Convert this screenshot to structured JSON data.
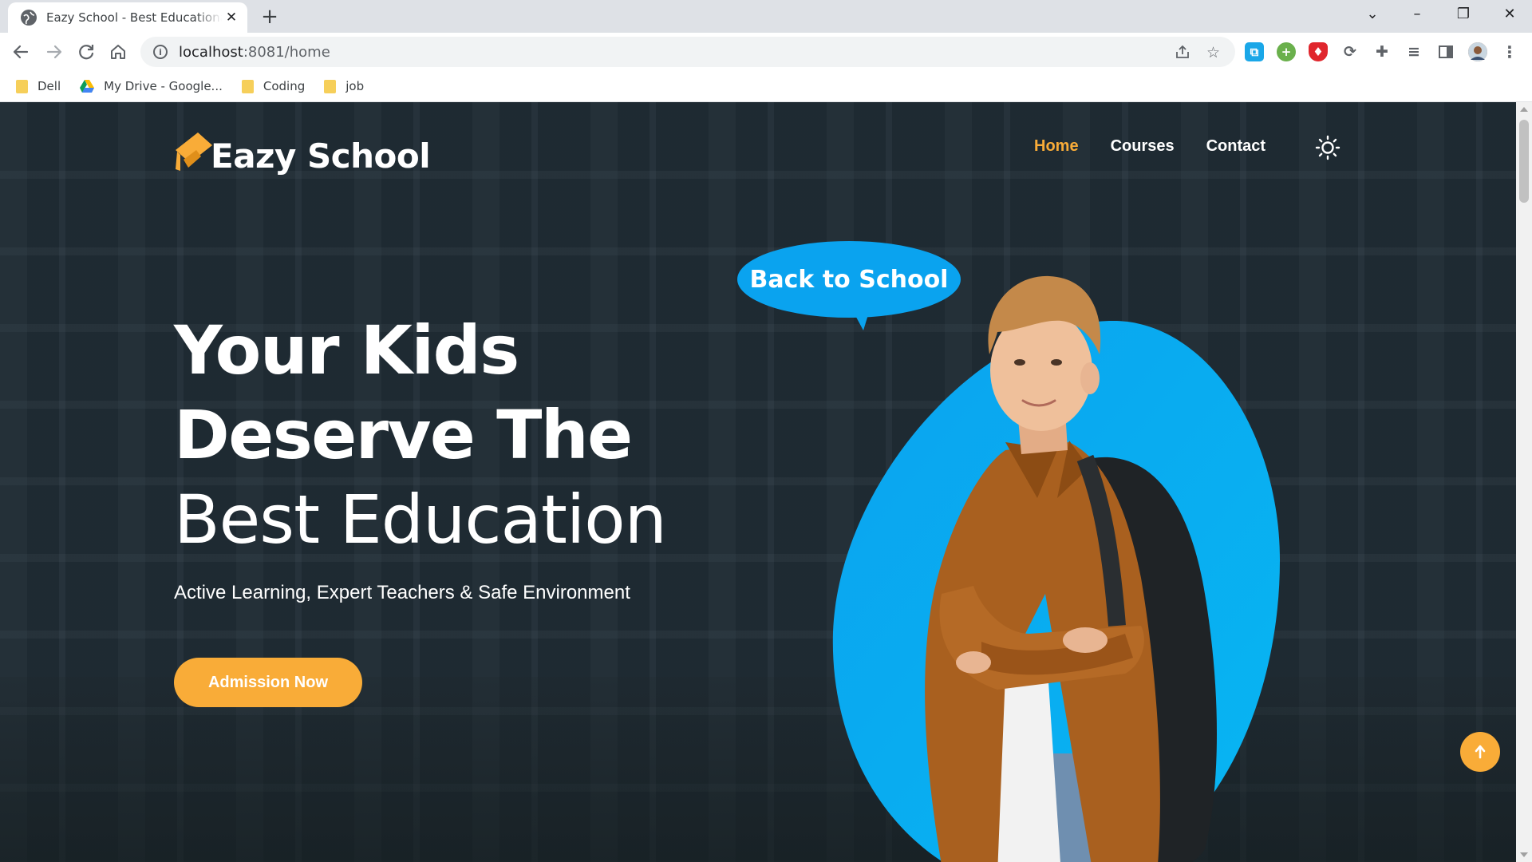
{
  "browser": {
    "tab_title": "Eazy School - Best Educational Institute",
    "url_host": "localhost",
    "url_path": ":8081/home",
    "bookmarks": [
      {
        "label": "Dell",
        "icon": "folder-icon"
      },
      {
        "label": "My Drive - Google...",
        "icon": "google-drive-icon"
      },
      {
        "label": "Coding",
        "icon": "folder-icon"
      },
      {
        "label": "job",
        "icon": "folder-icon"
      }
    ]
  },
  "site": {
    "brand": "Eazy School",
    "nav": [
      {
        "label": "Home",
        "active": true
      },
      {
        "label": "Courses",
        "active": false
      },
      {
        "label": "Contact",
        "active": false
      }
    ],
    "theme_toggle_icon": "sun-icon"
  },
  "hero": {
    "line1": "Your Kids",
    "line2": "Deserve The",
    "line3": "Best Education",
    "subtitle": "Active Learning, Expert Teachers & Safe Environment",
    "cta_label": "Admission Now",
    "bubble_text": "Back to School"
  },
  "colors": {
    "accent": "#f9ac38",
    "bubble_blue": "#0aa3ef",
    "overlay": "#1c2830"
  }
}
